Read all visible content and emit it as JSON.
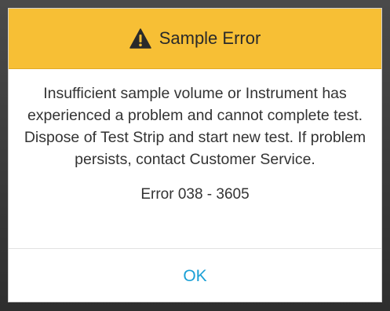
{
  "dialog": {
    "title": "Sample Error",
    "header_icon": "warning-icon",
    "message": "Insufficient sample volume or Instrument has experienced a problem and cannot complete test. Dispose of Test Strip and start new test. If problem persists, contact Customer Service.",
    "error_code": "Error 038 - 3605",
    "ok_label": "OK"
  },
  "colors": {
    "header_background": "#f7bf35",
    "button_text": "#1ba0d6",
    "body_text": "#333333"
  }
}
